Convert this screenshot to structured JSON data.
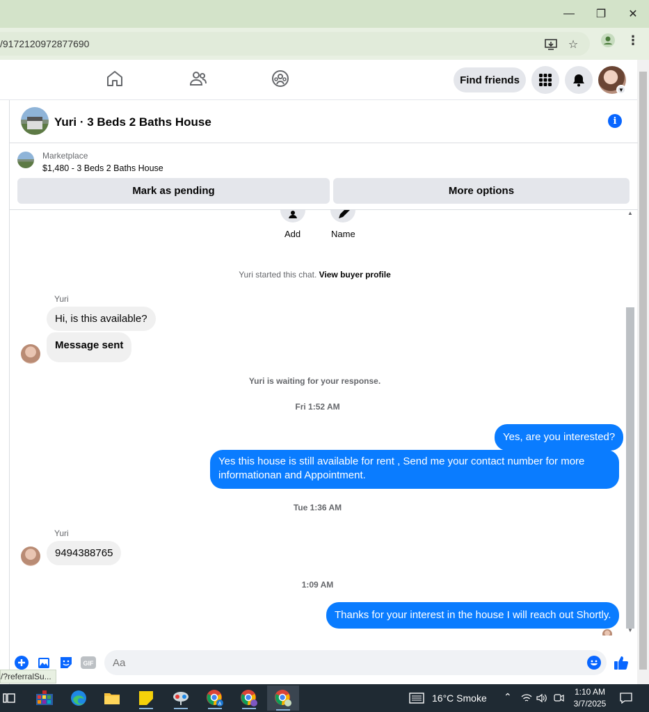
{
  "browser": {
    "url": "/9172120972877690"
  },
  "fbnav": {
    "find_friends": "Find friends"
  },
  "chat": {
    "title": "Yuri · 3 Beds 2 Baths House",
    "marketplace_label": "Marketplace",
    "listing": "$1,480 - 3 Beds 2 Baths House",
    "mark_pending": "Mark as pending",
    "more_options": "More options",
    "actions": [
      {
        "label": "Add"
      },
      {
        "label": "Name"
      }
    ],
    "started_text": "Yuri started this chat.",
    "view_profile": "View buyer profile",
    "messages": {
      "sender1": "Yuri",
      "m1": "Hi, is this available?",
      "m2": "Message sent",
      "waiting": "Yuri is waiting for your response.",
      "stamp1": "Fri 1:52 AM",
      "m3": "Yes, are you interested?",
      "m4": "Yes this house is still available for rent , Send me your contact number for more informationan and Appointment.",
      "stamp2": "Tue 1:36 AM",
      "sender2": "Yuri",
      "m5": "9494388765",
      "stamp3": "1:09 AM",
      "m6": "Thanks for your interest in the house I will reach out Shortly."
    },
    "composer_placeholder": "Aa"
  },
  "status_link": "/?referralSu...",
  "taskbar": {
    "weather": "16°C  Smoke",
    "time": "1:10 AM",
    "date": "3/7/2025"
  },
  "colors": {
    "accent": "#0866ff",
    "outgoing_bubble": "#0a7cff",
    "incoming_bubble": "#f0f0f0",
    "chrome_titlebar": "#d3e3c9",
    "taskbar": "#1f2a33"
  }
}
